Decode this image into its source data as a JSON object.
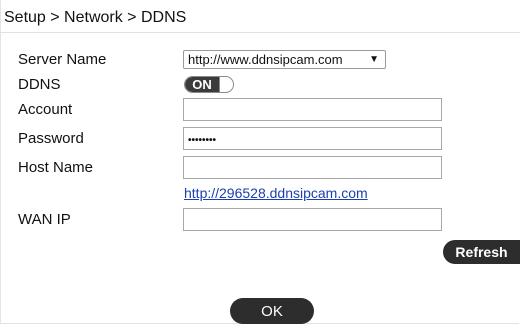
{
  "breadcrumb": {
    "text": "Setup > Network > DDNS"
  },
  "form": {
    "server_name": {
      "label": "Server Name",
      "selected": "http://www.ddnsipcam.com",
      "caret": "▼"
    },
    "ddns": {
      "label": "DDNS",
      "state": "ON"
    },
    "account": {
      "label": "Account",
      "value": ""
    },
    "password": {
      "label": "Password",
      "value": "••••••••"
    },
    "host_name": {
      "label": "Host Name",
      "value": "",
      "link": "http://296528.ddnsipcam.com"
    },
    "wan_ip": {
      "label": "WAN IP",
      "value": ""
    }
  },
  "buttons": {
    "refresh": "Refresh",
    "ok": "OK"
  },
  "colors": {
    "button_bg": "#2d2d2d",
    "link": "#1b3fb0",
    "toggle_on": "#3b3b3b"
  }
}
